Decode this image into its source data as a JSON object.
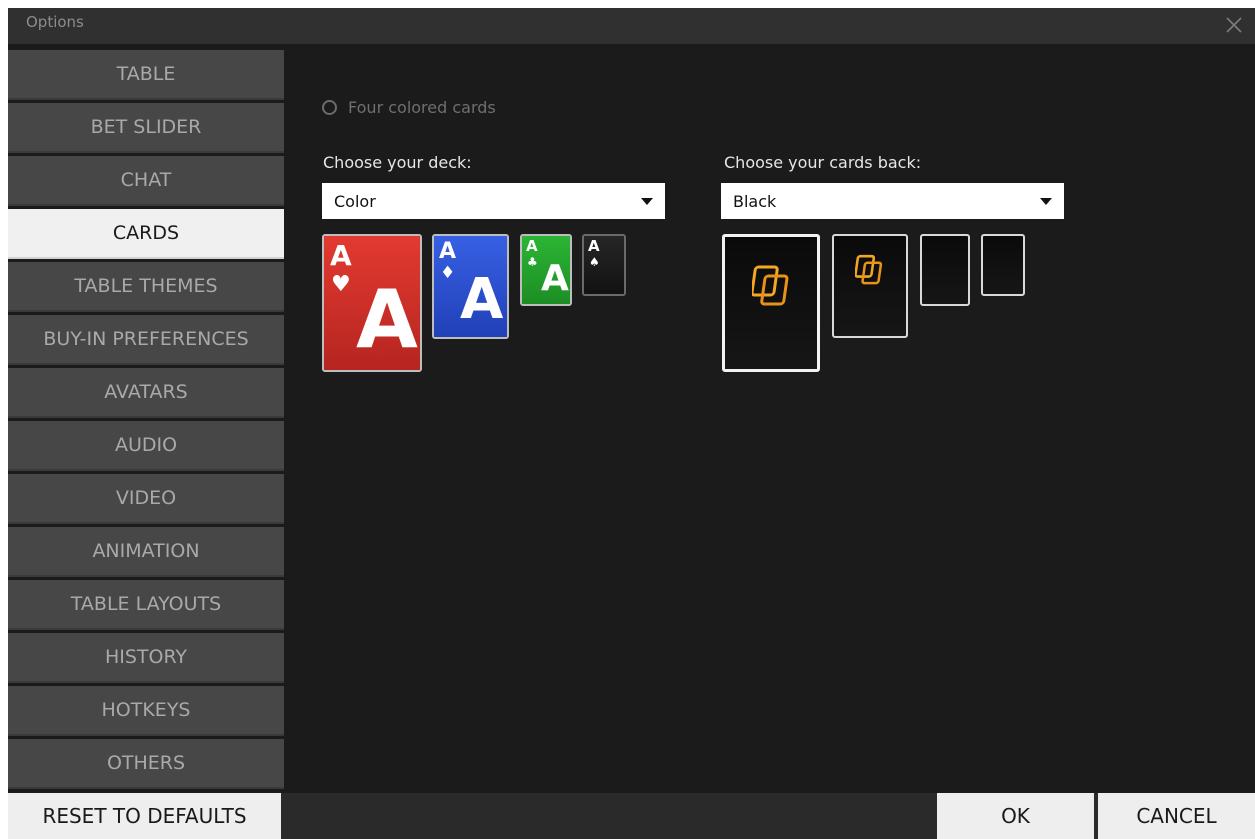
{
  "window": {
    "title": "Options"
  },
  "sidebar": {
    "items": [
      {
        "label": "TABLE",
        "active": false
      },
      {
        "label": "BET SLIDER",
        "active": false
      },
      {
        "label": "CHAT",
        "active": false
      },
      {
        "label": "CARDS",
        "active": true
      },
      {
        "label": "TABLE THEMES",
        "active": false
      },
      {
        "label": "BUY-IN PREFERENCES",
        "active": false
      },
      {
        "label": "AVATARS",
        "active": false
      },
      {
        "label": "AUDIO",
        "active": false
      },
      {
        "label": "VIDEO",
        "active": false
      },
      {
        "label": "ANIMATION",
        "active": false
      },
      {
        "label": "TABLE LAYOUTS",
        "active": false
      },
      {
        "label": "HISTORY",
        "active": false
      },
      {
        "label": "HOTKEYS",
        "active": false
      },
      {
        "label": "OTHERS",
        "active": false
      }
    ]
  },
  "cards": {
    "four_colored_label": "Four colored cards",
    "four_colored_checked": false,
    "deck": {
      "label": "Choose your deck:",
      "selected": "Color",
      "previews": [
        {
          "rank": "A",
          "suit": "♥",
          "color": "#d8302a"
        },
        {
          "rank": "A",
          "suit": "♦",
          "color": "#2a4fd0"
        },
        {
          "rank": "A",
          "suit": "♣",
          "color": "#21a62a"
        },
        {
          "rank": "A",
          "suit": "♠",
          "color": "#1e1e1e"
        }
      ]
    },
    "back": {
      "label": "Choose your cards back:",
      "selected": "Black",
      "accent": "#f5a623"
    }
  },
  "footer": {
    "reset_label": "RESET TO DEFAULTS",
    "ok_label": "OK",
    "cancel_label": "CANCEL"
  }
}
